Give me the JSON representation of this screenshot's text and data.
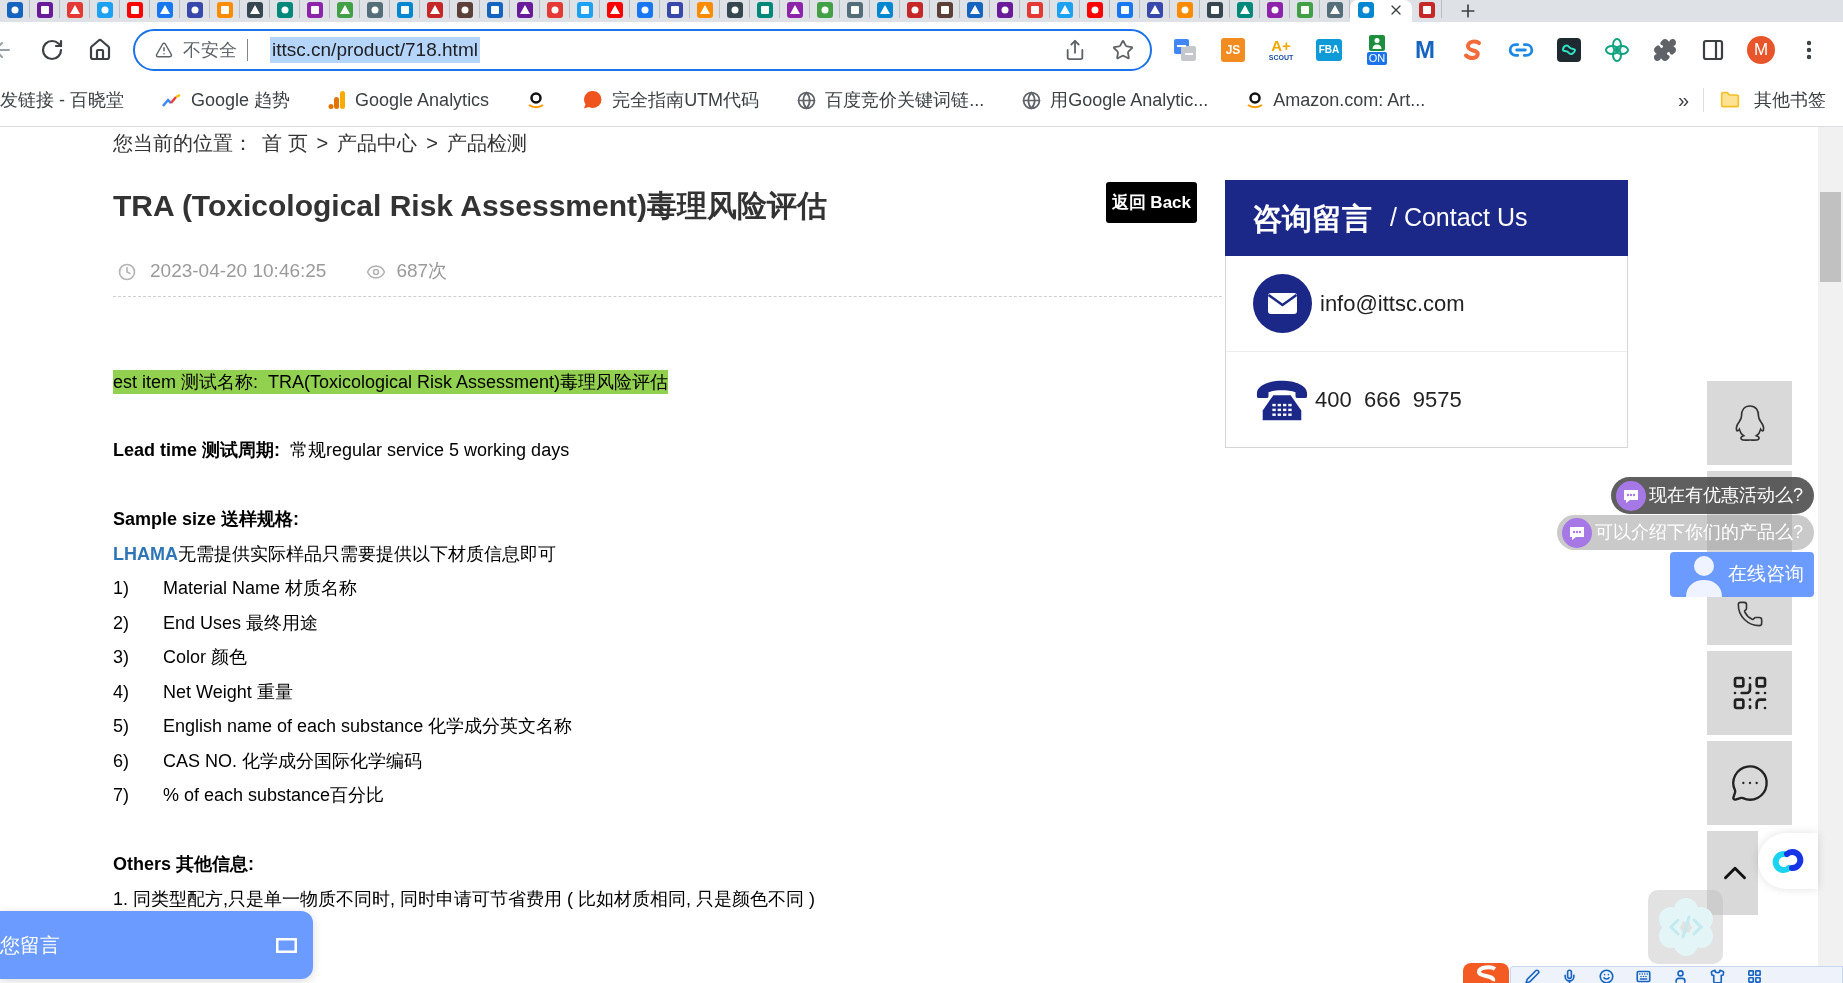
{
  "browser": {
    "tabs": [
      {
        "selected": false
      },
      {
        "selected": false
      },
      {
        "selected": false
      },
      {
        "selected": false
      },
      {
        "selected": false
      },
      {
        "selected": false
      },
      {
        "selected": false
      },
      {
        "selected": false
      },
      {
        "selected": false
      },
      {
        "selected": false
      },
      {
        "selected": false
      },
      {
        "selected": false
      },
      {
        "selected": false
      },
      {
        "selected": false
      },
      {
        "selected": false
      },
      {
        "selected": false
      },
      {
        "selected": false
      },
      {
        "selected": false
      },
      {
        "selected": false
      },
      {
        "selected": false
      },
      {
        "selected": false
      },
      {
        "selected": false
      },
      {
        "selected": false
      },
      {
        "selected": false
      },
      {
        "selected": false
      },
      {
        "selected": false
      },
      {
        "selected": false
      },
      {
        "selected": false
      },
      {
        "selected": false
      },
      {
        "selected": false
      },
      {
        "selected": false
      },
      {
        "selected": false
      },
      {
        "selected": false
      },
      {
        "selected": false
      },
      {
        "selected": false
      },
      {
        "selected": false
      },
      {
        "selected": false
      },
      {
        "selected": false
      },
      {
        "selected": false
      },
      {
        "selected": false
      },
      {
        "selected": false
      },
      {
        "selected": false
      },
      {
        "selected": false
      },
      {
        "selected": false
      },
      {
        "selected": false
      },
      {
        "selected": true
      },
      {
        "selected": false
      }
    ],
    "address": {
      "security": "不安全",
      "url": "ittsc.cn/product/718.html",
      "url_selected": true
    },
    "extensions": [
      {
        "kind": "translate"
      },
      {
        "kind": "tile",
        "label": "JS"
      },
      {
        "kind": "scout",
        "label": "A+",
        "sublabel": "SCOUT"
      },
      {
        "kind": "fba",
        "label": "FBA"
      },
      {
        "kind": "on",
        "label": "ON"
      },
      {
        "kind": "letter",
        "label": "M"
      },
      {
        "kind": "swirl"
      },
      {
        "kind": "link"
      },
      {
        "kind": "ai"
      },
      {
        "kind": "knot"
      },
      {
        "kind": "puzzle"
      },
      {
        "kind": "panel"
      }
    ],
    "profile": {
      "initial": "M"
    },
    "bookmarks": [
      {
        "kind": "plain",
        "label": "发链接 - 百晓堂"
      },
      {
        "kind": "trends",
        "label": "Google 趋势"
      },
      {
        "kind": "analytics",
        "label": "Google Analytics"
      },
      {
        "kind": "smile"
      },
      {
        "kind": "bubble",
        "label": "完全指南UTM代码"
      },
      {
        "kind": "globe",
        "label": "百度竞价关键词链..."
      },
      {
        "kind": "globe",
        "label": "用Google Analytic..."
      },
      {
        "kind": "smile",
        "label": "Amazon.com: Art..."
      }
    ],
    "more_bookmarks": "»",
    "other_bookmarks": "其他书签"
  },
  "page": {
    "breadcrumb": {
      "label": "您当前的位置：",
      "links": [
        "首 页",
        "产品中心",
        "产品检测"
      ],
      "separators": [
        ">",
        ">"
      ]
    },
    "title": "TRA (Toxicological Risk Assessment)毒理风险评估",
    "back_button": "返回 Back",
    "date": "2023-04-20 10:46:25",
    "views": "687次",
    "sections": [
      [
        {
          "kind": "highlight",
          "text": "est item 测试名称:  TRA(Toxicological Risk Assessment)毒理风险评估"
        }
      ],
      [
        {
          "kind": "paragraph",
          "text": "**Lead time 测试周期:**  常规regular service 5 working days"
        }
      ],
      [
        {
          "kind": "heading",
          "text": "Sample size 送样规格:"
        },
        {
          "kind": "intro",
          "link": "LHAMA",
          "text": "无需提供实际样品只需要提供以下材质信息即可"
        },
        {
          "kind": "item",
          "number": "1)",
          "text": "Material Name 材质名称"
        },
        {
          "kind": "item",
          "number": "2)",
          "text": "End Uses 最终用途"
        },
        {
          "kind": "item",
          "number": "3)",
          "text": "Color 颜色"
        },
        {
          "kind": "item",
          "number": "4)",
          "text": "Net Weight 重量"
        },
        {
          "kind": "item",
          "number": "5)",
          "text": "English name of each substance 化学成分英文名称"
        },
        {
          "kind": "item",
          "number": "6)",
          "text": "CAS NO. 化学成分国际化学编码"
        },
        {
          "kind": "item",
          "number": "7)",
          "text": "% of each substance百分比"
        }
      ],
      [
        {
          "kind": "heading",
          "text": "Others 其他信息:"
        },
        {
          "kind": "paragraph",
          "text": "1. 同类型配方,只是单一物质不同时, 同时申请可节省费用 ( 比如材质相同, 只是颜色不同 )"
        }
      ]
    ],
    "contact": {
      "title": "咨询留言",
      "subtitle": "/ Contact Us",
      "email": "info@ittsc.com",
      "phone": "400  666  9575"
    }
  },
  "widgets": {
    "side_tools": [
      {
        "kind": "qq"
      },
      {
        "kind": "covered"
      },
      {
        "kind": "phone"
      },
      {
        "kind": "qr"
      },
      {
        "kind": "chat"
      },
      {
        "kind": "top"
      }
    ],
    "prompts": [
      {
        "text": "现在有优惠活动么?",
        "faded": false
      },
      {
        "text": "可以介绍下你们的产品么?",
        "faded": true
      }
    ],
    "consult_button": "在线咨询",
    "message_panel": "您留言"
  }
}
